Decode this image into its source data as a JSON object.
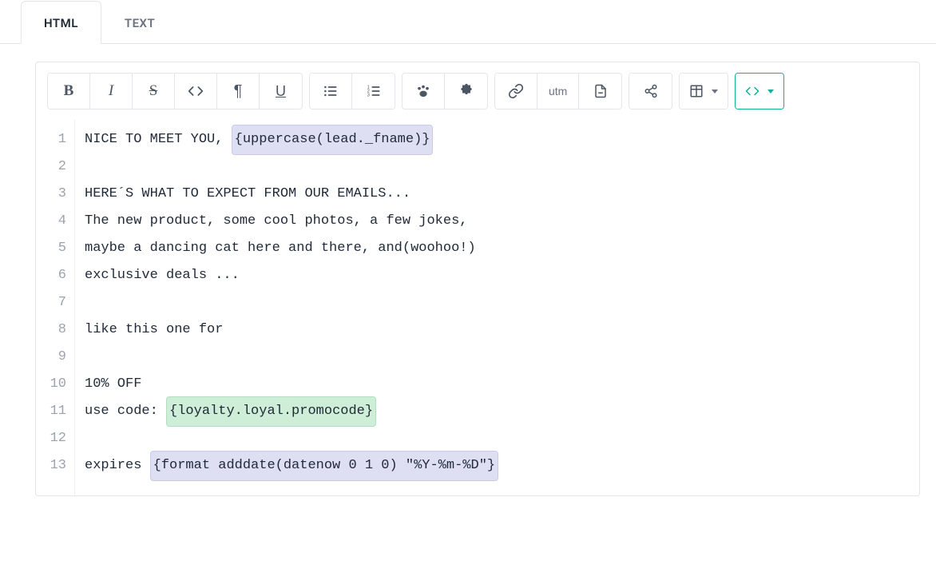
{
  "tabs": {
    "html": "HTML",
    "text": "TEXT"
  },
  "toolbar": {
    "utm": "utm"
  },
  "code": {
    "lines": [
      {
        "n": "1",
        "pre": "NICE TO MEET YOU, ",
        "token": "{uppercase(lead._fname)}",
        "tokenClass": "purple",
        "post": ""
      },
      {
        "n": "2",
        "pre": "",
        "token": "",
        "tokenClass": "",
        "post": ""
      },
      {
        "n": "3",
        "pre": "HERE´S WHAT TO EXPECT FROM OUR EMAILS...",
        "token": "",
        "tokenClass": "",
        "post": ""
      },
      {
        "n": "4",
        "pre": "The new product, some cool photos, a few jokes,",
        "token": "",
        "tokenClass": "",
        "post": ""
      },
      {
        "n": "5",
        "pre": "maybe a dancing cat here and there, and(woohoo!)",
        "token": "",
        "tokenClass": "",
        "post": ""
      },
      {
        "n": "6",
        "pre": "exclusive deals ...",
        "token": "",
        "tokenClass": "",
        "post": ""
      },
      {
        "n": "7",
        "pre": "",
        "token": "",
        "tokenClass": "",
        "post": ""
      },
      {
        "n": "8",
        "pre": "like this one for",
        "token": "",
        "tokenClass": "",
        "post": ""
      },
      {
        "n": "9",
        "pre": "",
        "token": "",
        "tokenClass": "",
        "post": ""
      },
      {
        "n": "10",
        "pre": "10% OFF",
        "token": "",
        "tokenClass": "",
        "post": ""
      },
      {
        "n": "11",
        "pre": "use code: ",
        "token": "{loyalty.loyal.promocode}",
        "tokenClass": "green",
        "post": ""
      },
      {
        "n": "12",
        "pre": "",
        "token": "",
        "tokenClass": "",
        "post": ""
      },
      {
        "n": "13",
        "pre": "expires ",
        "token": "{format adddate(datenow 0 1 0) \"%Y-%m-%D\"}",
        "tokenClass": "purple",
        "post": ""
      }
    ]
  }
}
